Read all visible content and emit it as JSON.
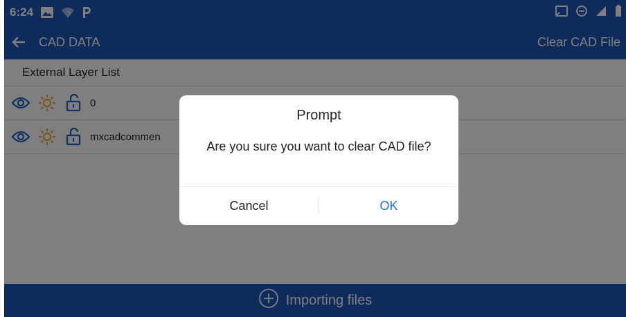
{
  "status_bar": {
    "time": "6:24",
    "left_icons": [
      "photo-icon",
      "wifi-question-icon",
      "parking-icon"
    ],
    "right_icons": [
      "cast-icon",
      "do-not-disturb-icon",
      "signal-icon",
      "battery-icon"
    ]
  },
  "app_bar": {
    "title": "CAD DATA",
    "clear_button": "Clear CAD File",
    "back_icon": "back-arrow-icon"
  },
  "layer_list": {
    "header": "External Layer List",
    "layers": [
      {
        "name": "0",
        "icons": [
          "eye-icon",
          "sun-icon",
          "unlock-icon"
        ]
      },
      {
        "name": "mxcadcommen",
        "icons": [
          "eye-icon",
          "sun-icon",
          "unlock-icon"
        ]
      }
    ]
  },
  "bottom_bar": {
    "label": "Importing files",
    "icon": "plus-circle-icon"
  },
  "dialog": {
    "title": "Prompt",
    "message": "Are you sure you want to clear CAD file?",
    "cancel_label": "Cancel",
    "ok_label": "OK"
  },
  "colors": {
    "primary": "#1c57b8",
    "accent_sun": "#f0a020",
    "icon_blue": "#1f5fc4",
    "ok_button": "#1f6fe0"
  }
}
